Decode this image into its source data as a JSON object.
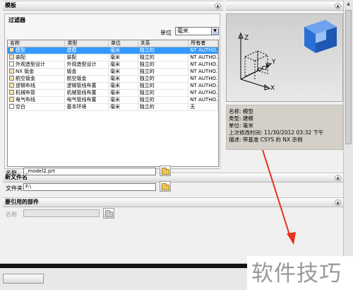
{
  "templates_section": {
    "title": "模板"
  },
  "filter": {
    "title": "过滤器",
    "unit_label": "单位",
    "unit_value": "毫米"
  },
  "table": {
    "columns": [
      "名称",
      "类型",
      "单位",
      "关系",
      "所有者"
    ],
    "rows": [
      {
        "name": "模型",
        "type": "建模",
        "unit": "毫米",
        "relation": "独立的",
        "owner": "NT AUTHO..."
      },
      {
        "name": "装配",
        "type": "装配",
        "unit": "毫米",
        "relation": "独立的",
        "owner": "NT AUTHO..."
      },
      {
        "name": "外观造型设计",
        "type": "外观造型设计",
        "unit": "毫米",
        "relation": "独立的",
        "owner": "NT AUTHO..."
      },
      {
        "name": "NX 钣金",
        "type": "钣金",
        "unit": "毫米",
        "relation": "独立的",
        "owner": "NT AUTHO..."
      },
      {
        "name": "航空钣金",
        "type": "航空钣金",
        "unit": "毫米",
        "relation": "独立的",
        "owner": "NT AUTHO..."
      },
      {
        "name": "逻辑布线",
        "type": "逻辑管线布置",
        "unit": "毫米",
        "relation": "独立的",
        "owner": "NT AUTHO..."
      },
      {
        "name": "机械布管",
        "type": "机械管线布置",
        "unit": "毫米",
        "relation": "独立的",
        "owner": "NT AUTHO..."
      },
      {
        "name": "电气布线",
        "type": "电气管线布置",
        "unit": "毫米",
        "relation": "独立的",
        "owner": "NT AUTHO..."
      },
      {
        "name": "空白",
        "type": "基本环境",
        "unit": "毫米",
        "relation": "独立的",
        "owner": "无"
      }
    ]
  },
  "preview": {
    "axis_z": "Z",
    "axis_y": "Y",
    "axis_x": "X",
    "icon": "modeling-cube-icon"
  },
  "info": {
    "name": "名称: 模型",
    "type": "类型: 建模",
    "unit": "单位: 毫米",
    "modified": "上次修改时间: 11/30/2012 03:32 下午",
    "description": "描述: 带基准 CSYS 的 NX 示例"
  },
  "new_file": {
    "title": "新文件名",
    "name_label": "名称",
    "name_value": "_model2.prt",
    "folder_label": "文件夹",
    "folder_value": "F:\\"
  },
  "referenced_part": {
    "title": "要引用的部件",
    "name_label": "名称",
    "name_value": ""
  },
  "watermark": {
    "text": "软件技巧"
  },
  "colors": {
    "selection": "#3399ff",
    "arrow": "#e8321e",
    "cube": "#2a6fd6"
  }
}
